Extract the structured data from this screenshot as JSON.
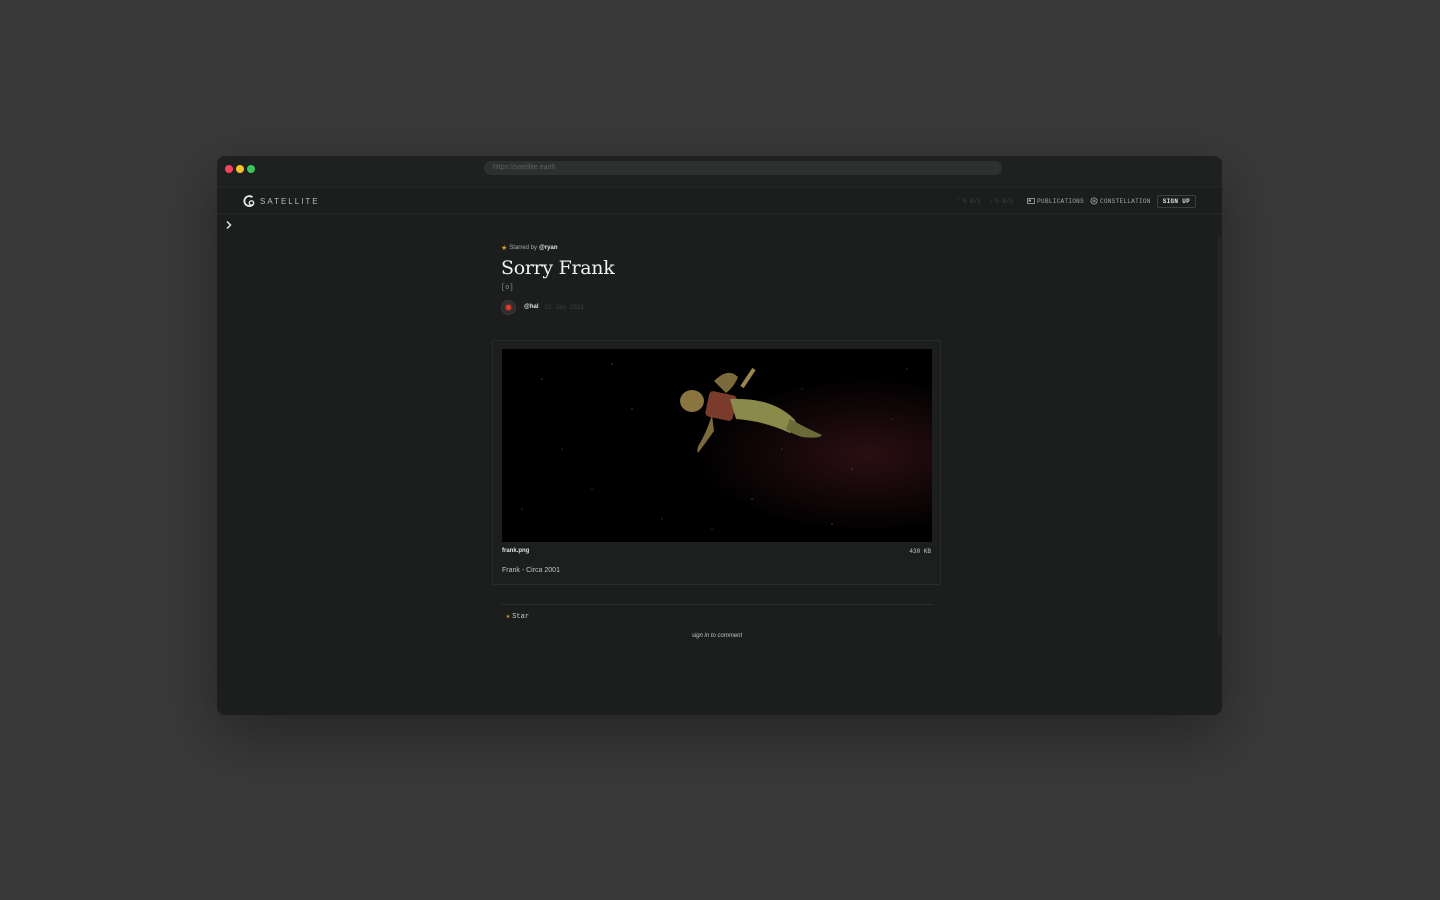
{
  "browser": {
    "url": "https://satellite.earth"
  },
  "nav": {
    "logo_text": "SATELLITE",
    "stat_up": "0 B/s",
    "stat_down": "0 B/s",
    "publications_label": "PUBLICATIONS",
    "constellation_label": "CONSTELLATION",
    "signup_label": "SIGN UP"
  },
  "post": {
    "starred_prefix": "Starred by",
    "starred_user": "@ryan",
    "title": "Sorry Frank",
    "slug": "[o]",
    "author": "@hal",
    "date": "23 Jan 2021"
  },
  "attachment": {
    "file_name": "frank.png",
    "file_size": "430 KB",
    "caption": "Frank - Circa 2001"
  },
  "actions": {
    "star_label": "Star",
    "sign_in_label": "sign in to comment"
  },
  "colors": {
    "page_bg": "#393939",
    "window_bg": "#1c1d1d",
    "star_accent": "#d9a22f",
    "hal_red": "#e33a2c"
  },
  "icons": [
    "satellite-logo-icon",
    "upload-arrow-icon",
    "download-arrow-icon",
    "publications-icon",
    "constellation-icon",
    "chevron-right-icon",
    "star-icon"
  ]
}
